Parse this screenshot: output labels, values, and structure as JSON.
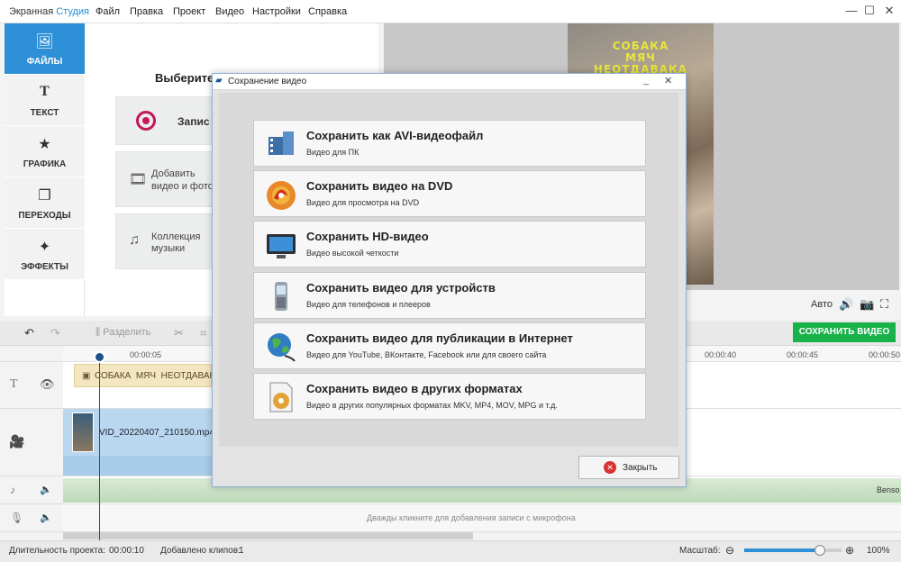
{
  "app": {
    "title_part1": "Экранная",
    "title_part2": "Студия"
  },
  "menu": [
    "Файл",
    "Правка",
    "Проект",
    "Видео",
    "Настройки",
    "Справка"
  ],
  "window_controls": {
    "minimize": "—",
    "maximize": "☐",
    "close": "✕"
  },
  "nav": [
    {
      "label": "ФАЙЛЫ",
      "icon": "image-icon",
      "active": true
    },
    {
      "label": "ТЕКСТ",
      "icon": "text-icon",
      "active": false
    },
    {
      "label": "ГРАФИКА",
      "icon": "star-icon",
      "active": false
    },
    {
      "label": "ПЕРЕХОДЫ",
      "icon": "transitions-icon",
      "active": false
    },
    {
      "label": "ЭФФЕКТЫ",
      "icon": "magic-wand-icon",
      "active": false
    }
  ],
  "files_panel": {
    "title": "Выберите",
    "record_label": "Запис",
    "add_media_label_1": "Добавить",
    "add_media_label_2": "видео и фото",
    "music_label_1": "Коллекция",
    "music_label_2": "музыки"
  },
  "preview": {
    "overlay_lines": [
      "СОБАКА",
      "МЯЧ",
      "НЕОТДАВАКА"
    ],
    "auto_label": "Авто"
  },
  "toolbar": {
    "split_label": "Разделить",
    "save_video_label": "СОХРАНИТЬ ВИДЕО"
  },
  "timeline": {
    "ticks": [
      "00:00:05",
      "00:00:40",
      "00:00:45",
      "00:00:50"
    ],
    "text_clip": "СОБАКА  МЯЧ  НЕОТДАВАКА",
    "video_clip": "VID_20220407_210150.mp4",
    "audio_track_label": "Benso",
    "mic_hint": "Дважды кликните для добавления записи с микрофона"
  },
  "status": {
    "duration_label": "Длительность проекта:",
    "duration_value": "00:00:10",
    "clips_label": "Добавлено клипов:",
    "clips_value": "1",
    "zoom_label": "Масштаб:",
    "zoom_value": "100%",
    "zoom_level": 0.78
  },
  "dialog": {
    "title": "Сохранение видео",
    "options": [
      {
        "title": "Сохранить как AVI-видеофайл",
        "subtitle": "Видео для ПК",
        "icon": "film-icon"
      },
      {
        "title": "Сохранить видео на DVD",
        "subtitle": "Видео для просмотра на DVD",
        "icon": "dvd-icon"
      },
      {
        "title": "Сохранить HD-видео",
        "subtitle": "Видео высокой четкости",
        "icon": "monitor-icon"
      },
      {
        "title": "Сохранить видео для устройств",
        "subtitle": "Видео для телефонов и плееров",
        "icon": "phone-icon"
      },
      {
        "title": "Сохранить видео для публикации в Интернет",
        "subtitle": "Видео для YouTube, ВКонтакте, Facebook или для своего сайта",
        "icon": "globe-icon"
      },
      {
        "title": "Сохранить видео в других форматах",
        "subtitle": "Видео в других популярных форматах MKV, MP4, MOV, MPG и т.д.",
        "icon": "document-film-icon"
      }
    ],
    "close_label": "Закрыть"
  },
  "colors": {
    "accent": "#2d8fd5",
    "save_green": "#19b14a",
    "dialog_border": "#8fb2d6"
  }
}
